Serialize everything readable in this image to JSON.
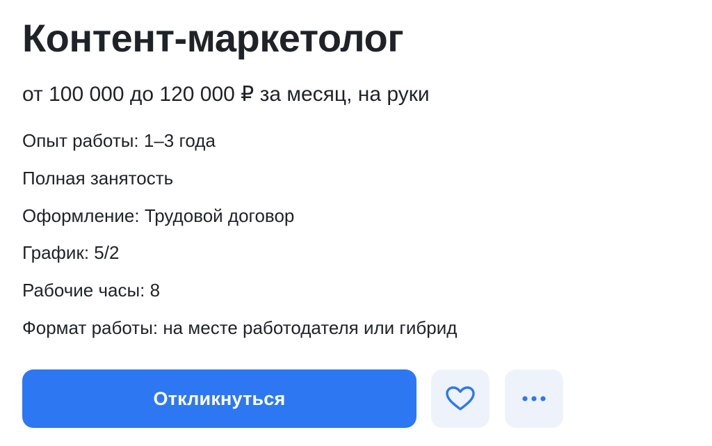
{
  "vacancy": {
    "title": "Контент-маркетолог",
    "salary": "от 100 000 до 120 000 ₽ за месяц, на руки",
    "details": [
      "Опыт работы: 1–3 года",
      "Полная занятость",
      "Оформление: Трудовой договор",
      "График: 5/2",
      "Рабочие часы: 8",
      "Формат работы: на месте работодателя или гибрид"
    ]
  },
  "actions": {
    "respond_label": "Откликнуться",
    "favorite_icon": "heart-icon",
    "more_icon": "more-horizontal-icon"
  },
  "colors": {
    "accent": "#2d78f2",
    "icon_button_bg": "#eef3fb",
    "text": "#1f2327"
  }
}
